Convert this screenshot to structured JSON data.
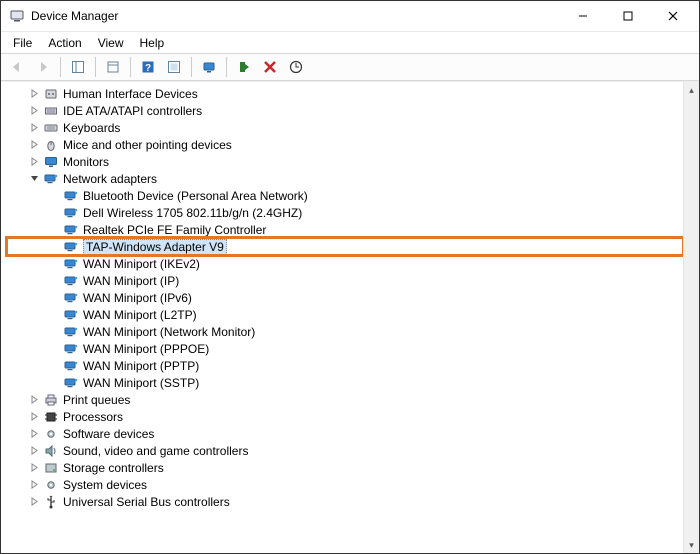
{
  "window": {
    "title": "Device Manager"
  },
  "menus": {
    "file": "File",
    "action": "Action",
    "view": "View",
    "help": "Help"
  },
  "tree": {
    "top": [
      {
        "name": "human-interface-devices",
        "label": "Human Interface Devices",
        "expanded": false
      },
      {
        "name": "ide-ata-atapi",
        "label": "IDE ATA/ATAPI controllers",
        "expanded": false
      },
      {
        "name": "keyboards",
        "label": "Keyboards",
        "expanded": false
      },
      {
        "name": "mice-pointing",
        "label": "Mice and other pointing devices",
        "expanded": false
      },
      {
        "name": "monitors",
        "label": "Monitors",
        "expanded": false
      }
    ],
    "network": {
      "label": "Network adapters",
      "expanded": true,
      "children": [
        {
          "label": "Bluetooth Device (Personal Area Network)"
        },
        {
          "label": "Dell Wireless 1705 802.11b/g/n (2.4GHZ)"
        },
        {
          "label": "Realtek PCIe FE Family Controller"
        },
        {
          "label": "TAP-Windows Adapter V9",
          "highlighted": true,
          "selected": true
        },
        {
          "label": "WAN Miniport (IKEv2)"
        },
        {
          "label": "WAN Miniport (IP)"
        },
        {
          "label": "WAN Miniport (IPv6)"
        },
        {
          "label": "WAN Miniport (L2TP)"
        },
        {
          "label": "WAN Miniport (Network Monitor)"
        },
        {
          "label": "WAN Miniport (PPPOE)"
        },
        {
          "label": "WAN Miniport (PPTP)"
        },
        {
          "label": "WAN Miniport (SSTP)"
        }
      ]
    },
    "bottom": [
      {
        "name": "print-queues",
        "label": "Print queues"
      },
      {
        "name": "processors",
        "label": "Processors"
      },
      {
        "name": "software-devices",
        "label": "Software devices"
      },
      {
        "name": "sound-video-game",
        "label": "Sound, video and game controllers"
      },
      {
        "name": "storage-controllers",
        "label": "Storage controllers"
      },
      {
        "name": "system-devices",
        "label": "System devices"
      },
      {
        "name": "usb-controllers",
        "label": "Universal Serial Bus controllers"
      }
    ]
  }
}
